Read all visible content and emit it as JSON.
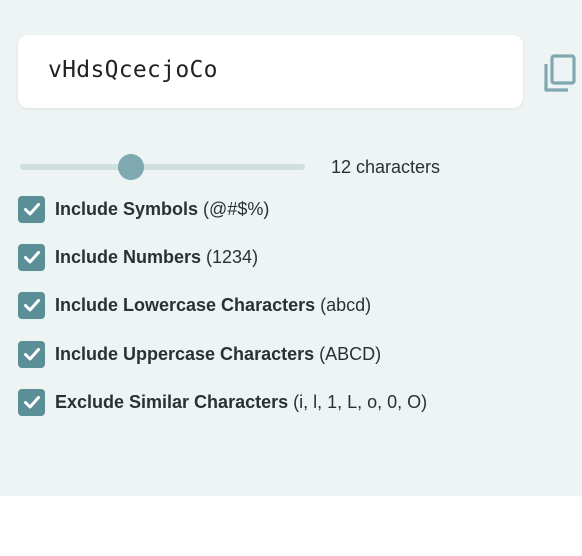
{
  "password": {
    "value": "vHdsQcecjoCo"
  },
  "copy": {
    "icon": "copy-icon"
  },
  "length": {
    "value": 12,
    "label": "12 characters",
    "min": 4,
    "max": 32
  },
  "options": [
    {
      "label": "Include Symbols",
      "hint": "(@#$%)",
      "checked": true
    },
    {
      "label": "Include Numbers",
      "hint": "(1234)",
      "checked": true
    },
    {
      "label": "Include Lowercase Characters",
      "hint": "(abcd)",
      "checked": true
    },
    {
      "label": "Include Uppercase Characters",
      "hint": "(ABCD)",
      "checked": true
    },
    {
      "label": "Exclude Similar Characters",
      "hint": "(i, l, 1, L, o, 0, O)",
      "checked": true
    }
  ],
  "colors": {
    "panel_bg": "#eef4f3",
    "accent": "#5b8f98",
    "slider_thumb": "#7fa8b0",
    "slider_track": "#cfdfe0"
  }
}
